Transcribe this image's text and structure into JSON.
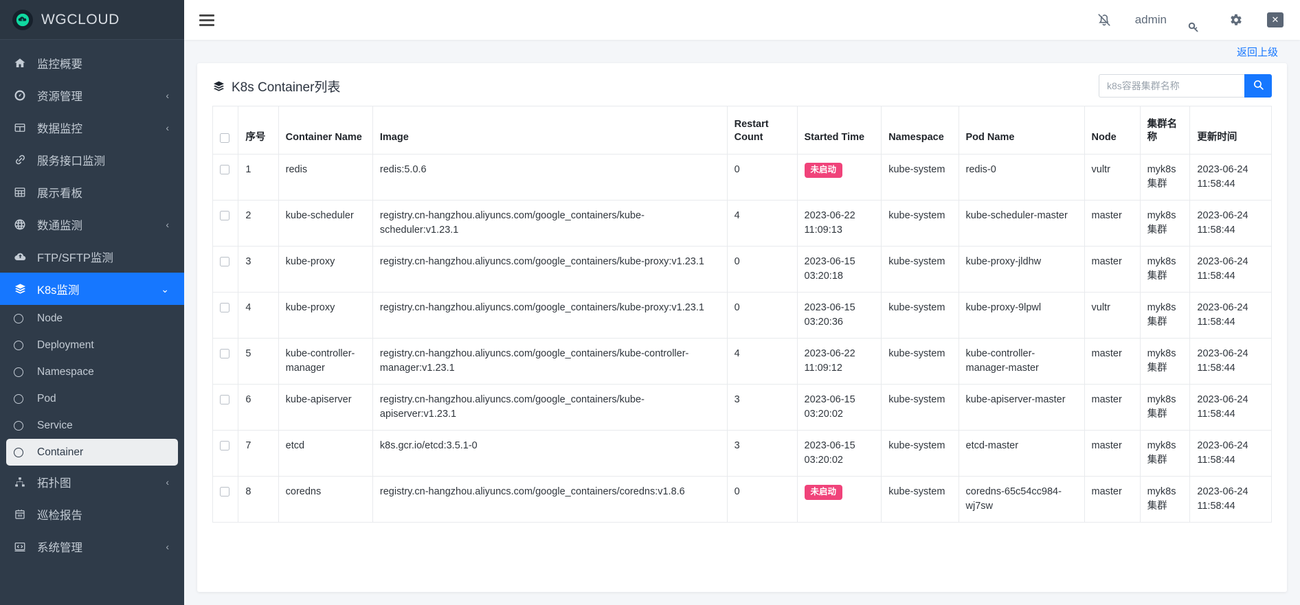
{
  "brand": {
    "title": "WGCLOUD",
    "logo_icon": "cloud-logo-icon"
  },
  "sidebar": {
    "items": [
      {
        "label": "监控概要",
        "icon": "home-icon",
        "caret": "",
        "type": "item"
      },
      {
        "label": "资源管理",
        "icon": "dashboard-gauge-icon",
        "caret": "‹",
        "type": "item"
      },
      {
        "label": "数据监控",
        "icon": "grid-table-icon",
        "caret": "‹",
        "type": "item"
      },
      {
        "label": "服务接口监测",
        "icon": "link-chain-icon",
        "caret": "",
        "type": "item"
      },
      {
        "label": "展示看板",
        "icon": "board-icon",
        "caret": "",
        "type": "item"
      },
      {
        "label": "数通监测",
        "icon": "globe-icon",
        "caret": "‹",
        "type": "item"
      },
      {
        "label": "FTP/SFTP监测",
        "icon": "cloud-upload-icon",
        "caret": "",
        "type": "item"
      },
      {
        "label": "K8s监测",
        "icon": "layers-icon",
        "caret": "⌄",
        "type": "item",
        "active": true
      },
      {
        "label": "Node",
        "icon": "circle-icon",
        "type": "sub"
      },
      {
        "label": "Deployment",
        "icon": "circle-icon",
        "type": "sub"
      },
      {
        "label": "Namespace",
        "icon": "circle-icon",
        "type": "sub"
      },
      {
        "label": "Pod",
        "icon": "circle-icon",
        "type": "sub"
      },
      {
        "label": "Service",
        "icon": "circle-icon",
        "type": "sub"
      },
      {
        "label": "Container",
        "icon": "circle-icon",
        "type": "sub",
        "selected": true
      },
      {
        "label": "拓扑图",
        "icon": "sitemap-icon",
        "caret": "‹",
        "type": "item"
      },
      {
        "label": "巡检报告",
        "icon": "calendar-report-icon",
        "caret": "",
        "type": "item"
      },
      {
        "label": "系统管理",
        "icon": "system-code-icon",
        "caret": "‹",
        "type": "item"
      }
    ]
  },
  "topbar": {
    "menu_icon": "hamburger-icon",
    "bell_off_icon": "bell-slash-icon",
    "user": "admin",
    "key_icon": "key-icon",
    "gear_icon": "gear-icon",
    "logout_icon": "logout-close-icon",
    "logout_glyph": "✕"
  },
  "content": {
    "back_link": "返回上级",
    "card_title": "K8s Container列表",
    "card_title_icon": "layers-icon",
    "search": {
      "placeholder": "k8s容器集群名称",
      "value": "",
      "button_icon": "search-icon"
    }
  },
  "table": {
    "columns": [
      "",
      "序号",
      "Container Name",
      "Image",
      "Restart Count",
      "Started Time",
      "Namespace",
      "Pod Name",
      "Node",
      "集群名称",
      "更新时间"
    ],
    "rows": [
      {
        "index": "1",
        "container_name": "redis",
        "image": "redis:5.0.6",
        "restart_count": "0",
        "started_time": "未启动",
        "started_is_badge": true,
        "namespace": "kube-system",
        "pod_name": "redis-0",
        "node": "vultr",
        "cluster": "myk8s集群",
        "updated": "2023-06-24 11:58:44"
      },
      {
        "index": "2",
        "container_name": "kube-scheduler",
        "image": "registry.cn-hangzhou.aliyuncs.com/google_containers/kube-scheduler:v1.23.1",
        "restart_count": "4",
        "started_time": "2023-06-22 11:09:13",
        "started_is_badge": false,
        "namespace": "kube-system",
        "pod_name": "kube-scheduler-master",
        "node": "master",
        "cluster": "myk8s集群",
        "updated": "2023-06-24 11:58:44"
      },
      {
        "index": "3",
        "container_name": "kube-proxy",
        "image": "registry.cn-hangzhou.aliyuncs.com/google_containers/kube-proxy:v1.23.1",
        "restart_count": "0",
        "started_time": "2023-06-15 03:20:18",
        "started_is_badge": false,
        "namespace": "kube-system",
        "pod_name": "kube-proxy-jldhw",
        "node": "master",
        "cluster": "myk8s集群",
        "updated": "2023-06-24 11:58:44"
      },
      {
        "index": "4",
        "container_name": "kube-proxy",
        "image": "registry.cn-hangzhou.aliyuncs.com/google_containers/kube-proxy:v1.23.1",
        "restart_count": "0",
        "started_time": "2023-06-15 03:20:36",
        "started_is_badge": false,
        "namespace": "kube-system",
        "pod_name": "kube-proxy-9lpwl",
        "node": "vultr",
        "cluster": "myk8s集群",
        "updated": "2023-06-24 11:58:44"
      },
      {
        "index": "5",
        "container_name": "kube-controller-manager",
        "image": "registry.cn-hangzhou.aliyuncs.com/google_containers/kube-controller-manager:v1.23.1",
        "restart_count": "4",
        "started_time": "2023-06-22 11:09:12",
        "started_is_badge": false,
        "namespace": "kube-system",
        "pod_name": "kube-controller-manager-master",
        "node": "master",
        "cluster": "myk8s集群",
        "updated": "2023-06-24 11:58:44"
      },
      {
        "index": "6",
        "container_name": "kube-apiserver",
        "image": "registry.cn-hangzhou.aliyuncs.com/google_containers/kube-apiserver:v1.23.1",
        "restart_count": "3",
        "started_time": "2023-06-15 03:20:02",
        "started_is_badge": false,
        "namespace": "kube-system",
        "pod_name": "kube-apiserver-master",
        "node": "master",
        "cluster": "myk8s集群",
        "updated": "2023-06-24 11:58:44"
      },
      {
        "index": "7",
        "container_name": "etcd",
        "image": "k8s.gcr.io/etcd:3.5.1-0",
        "restart_count": "3",
        "started_time": "2023-06-15 03:20:02",
        "started_is_badge": false,
        "namespace": "kube-system",
        "pod_name": "etcd-master",
        "node": "master",
        "cluster": "myk8s集群",
        "updated": "2023-06-24 11:58:44"
      },
      {
        "index": "8",
        "container_name": "coredns",
        "image": "registry.cn-hangzhou.aliyuncs.com/google_containers/coredns:v1.8.6",
        "restart_count": "0",
        "started_time": "未启动",
        "started_is_badge": true,
        "namespace": "kube-system",
        "pod_name": "coredns-65c54cc984-wj7sw",
        "node": "master",
        "cluster": "myk8s集群",
        "updated": "2023-06-24 11:58:44"
      }
    ]
  },
  "colors": {
    "accent": "#1677ff",
    "sidebar_bg": "#2f3b49",
    "badge_off": "#f0437a"
  }
}
